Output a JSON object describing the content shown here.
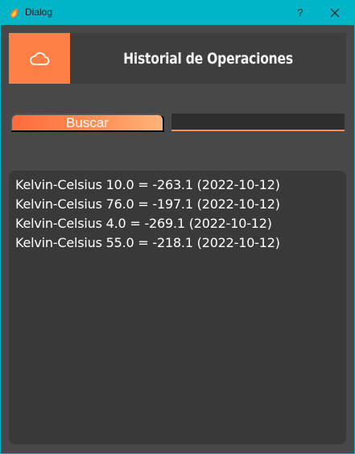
{
  "window": {
    "title": "Dialog",
    "help_label": "?",
    "accent_color": "#00b5c7"
  },
  "header": {
    "icon": "cloud-icon",
    "title": "Historial de Operaciones",
    "accent_color": "#ff7f45"
  },
  "search": {
    "button_label": "Buscar",
    "input_value": "",
    "input_placeholder": ""
  },
  "results": [
    "Kelvin-Celsius 10.0 = -263.1 (2022-10-12)",
    "Kelvin-Celsius 76.0 = -197.1 (2022-10-12)",
    "Kelvin-Celsius 4.0 = -269.1 (2022-10-12)",
    "Kelvin-Celsius 55.0 = -218.1 (2022-10-12)"
  ]
}
